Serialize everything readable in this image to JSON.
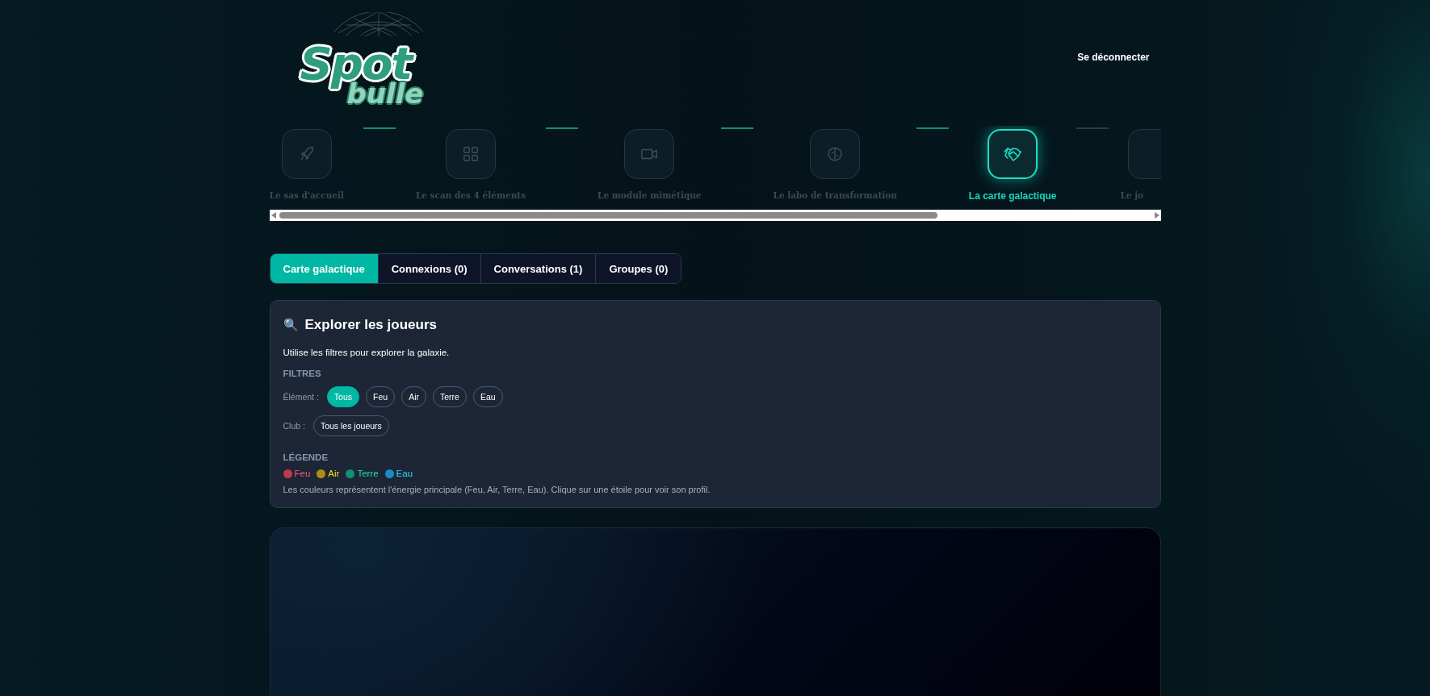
{
  "logo": {
    "line1": "Spot",
    "line2": "bulle"
  },
  "header": {
    "logout": "Se déconnecter"
  },
  "steps": [
    {
      "label": "Le sas d'accueil",
      "selected": false
    },
    {
      "label": "Le scan des 4 éléments",
      "selected": false
    },
    {
      "label": "Le module mimétique",
      "selected": false
    },
    {
      "label": "Le labo de transformation",
      "selected": false
    },
    {
      "label": "La carte galactique",
      "selected": true
    },
    {
      "label": "Le jo",
      "selected": false
    }
  ],
  "tabs": [
    {
      "label": "Carte galactique",
      "selected": true
    },
    {
      "label": "Connexions (0)",
      "selected": false
    },
    {
      "label": "Conversations (1)",
      "selected": false
    },
    {
      "label": "Groupes (0)",
      "selected": false
    }
  ],
  "explore": {
    "icon": "🔍",
    "title": "Explorer les joueurs",
    "intro": "Utilise les filtres pour explorer la galaxie.",
    "filters_heading": "FILTRES",
    "element_label": "Élément :",
    "elements": [
      {
        "label": "Tous",
        "selected": true
      },
      {
        "label": "Feu",
        "selected": false
      },
      {
        "label": "Air",
        "selected": false
      },
      {
        "label": "Terre",
        "selected": false
      },
      {
        "label": "Eau",
        "selected": false
      }
    ],
    "club_label": "Club :",
    "clubs": [
      {
        "label": "Tous les joueurs",
        "selected": false
      }
    ],
    "legend_heading": "LÉGENDE",
    "legend": [
      {
        "label": "Feu",
        "color": "#c0394a"
      },
      {
        "label": "Air",
        "color": "#b08d12"
      },
      {
        "label": "Terre",
        "color": "#119072"
      },
      {
        "label": "Eau",
        "color": "#1a8cc4"
      }
    ],
    "note": "Les couleurs représentent l'énergie principale (Feu, Air, Terre, Eau). Clique sur une étoile pour voir son profil."
  }
}
